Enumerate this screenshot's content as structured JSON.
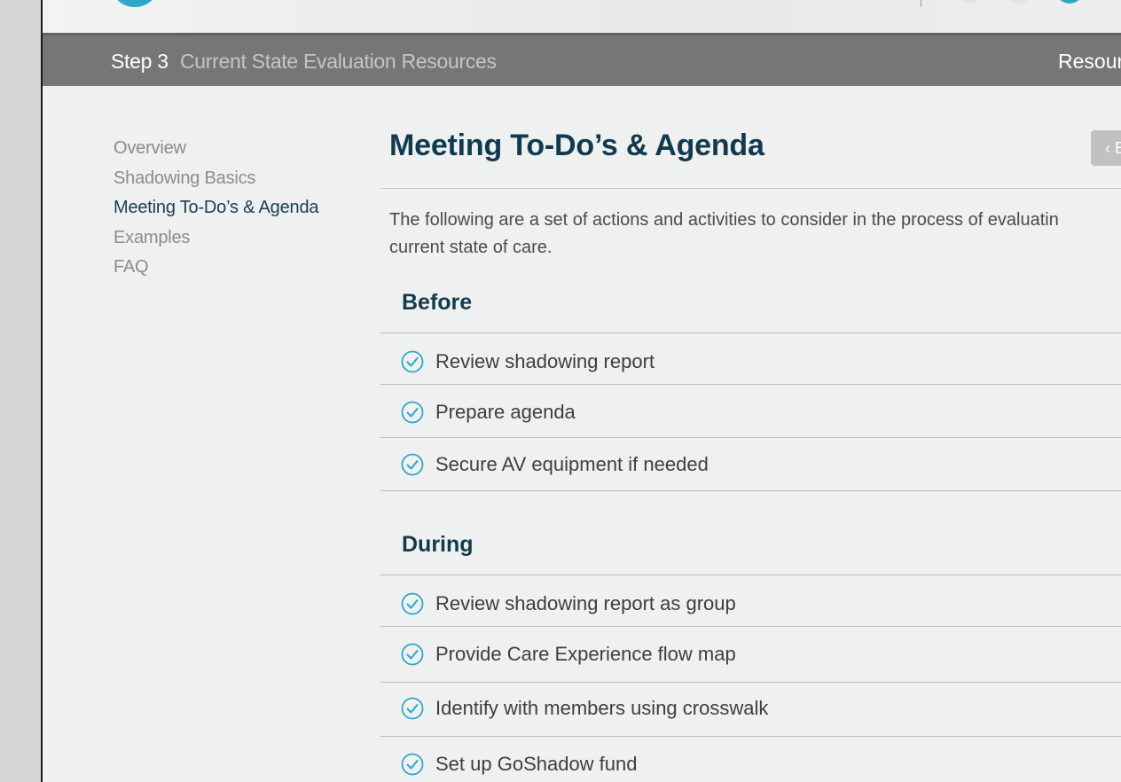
{
  "header": {
    "step_label": "Step 3",
    "step_title": "Current State Evaluation Resources",
    "right_link": "Resour"
  },
  "sidebar": {
    "items": [
      {
        "label": "Overview",
        "active": false
      },
      {
        "label": "Shadowing Basics",
        "active": false
      },
      {
        "label": "Meeting To-Do’s & Agenda",
        "active": true
      },
      {
        "label": "Examples",
        "active": false
      },
      {
        "label": "FAQ",
        "active": false
      }
    ]
  },
  "main": {
    "title": "Meeting To-Do’s & Agenda",
    "back_button_label": "‹ B",
    "intro_line_1": "The following are a set of actions and activities to consider in the process of evaluatin",
    "intro_line_2": "current state of care.",
    "sections": [
      {
        "heading": "Before",
        "items": [
          "Review shadowing report",
          "Prepare agenda",
          "Secure AV equipment if needed"
        ]
      },
      {
        "heading": "During",
        "items": [
          "Review shadowing report as group",
          "Provide Care Experience flow map",
          "Identify with members using crosswalk",
          "Set up GoShadow fund"
        ]
      }
    ]
  },
  "colors": {
    "accent": "#2ea7c9",
    "heading": "#113a4e",
    "stepbar": "#757776",
    "background": "#eff1f0"
  },
  "icons": {
    "checklist_item": "check-circle-icon"
  }
}
